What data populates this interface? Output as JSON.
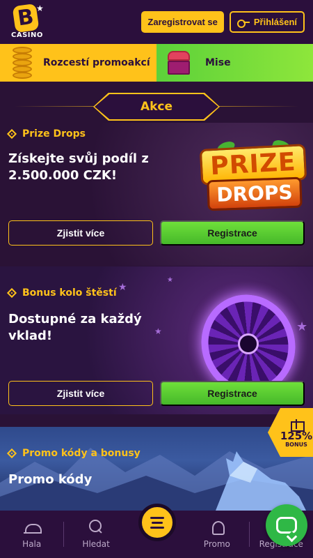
{
  "header": {
    "logo_text": "CASINO",
    "logo_letter": "B",
    "register_label": "Zaregistrovat se",
    "login_label": "Přihlášení"
  },
  "promo_bar": {
    "left_label": "Rozcestí promoakcí",
    "right_label": "Mise"
  },
  "section": {
    "title": "Akce"
  },
  "cards": [
    {
      "label": "Prize Drops",
      "title": "Získejte svůj podíl z 2.500.000 CZK!",
      "more_label": "Zjistit více",
      "register_label": "Registrace",
      "art_word_1": "PRIZE",
      "art_word_2": "DROPS"
    },
    {
      "label": "Bonus kolo štěstí",
      "title": "Dostupné za každý vklad!",
      "more_label": "Zjistit více",
      "register_label": "Registrace"
    },
    {
      "label": "Promo kódy a bonusy",
      "title": "Promo kódy"
    }
  ],
  "bonus_badge": {
    "percent": "125%",
    "label": "BONUS"
  },
  "bottom_nav": {
    "items": [
      {
        "label": "Hala",
        "icon": "bell-icon"
      },
      {
        "label": "Hledat",
        "icon": "search-icon"
      },
      {
        "label": "Promo",
        "icon": "promo-icon"
      },
      {
        "label": "Registrace",
        "icon": "user-icon"
      }
    ]
  },
  "colors": {
    "accent": "#ffc21a",
    "green": "#46b82a",
    "background": "#2a1236"
  }
}
